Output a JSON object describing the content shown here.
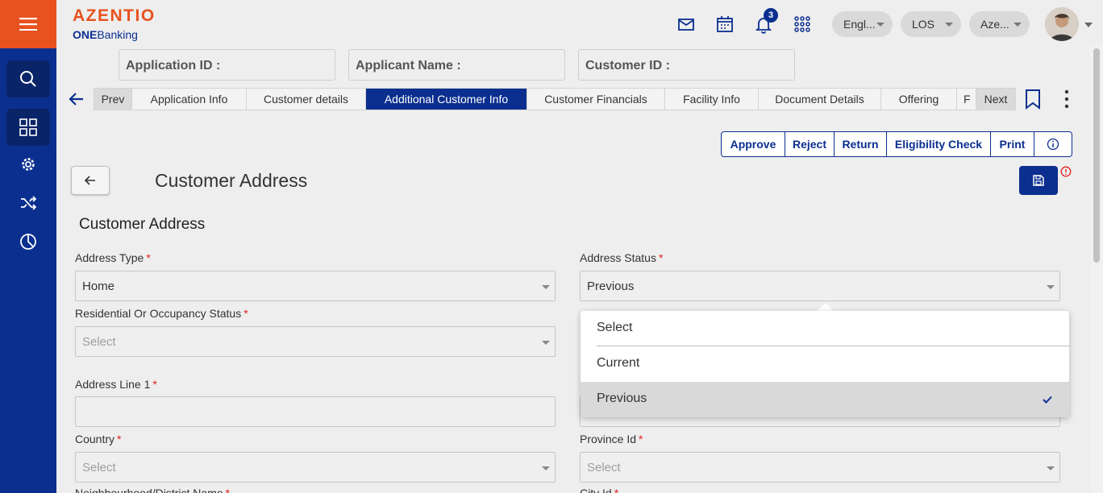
{
  "brand": {
    "name": "AZENTIO",
    "sub_bold": "ONE",
    "sub_rest": "Banking"
  },
  "header": {
    "notification_count": "3",
    "language": "Engl...",
    "module": "LOS",
    "entity": "Aze...",
    "icons": [
      "mail-icon",
      "calendar-icon",
      "bell-icon",
      "apps-grid-icon"
    ]
  },
  "rail": {
    "items": [
      "menu-icon",
      "search-icon",
      "dashboard-icon",
      "settings-icon",
      "shuffle-icon",
      "pie-chart-icon"
    ]
  },
  "id_fields": {
    "application_id": "Application ID :",
    "applicant_name": "Applicant Name :",
    "customer_id": "Customer ID :"
  },
  "tabs": {
    "prev": "Prev",
    "next": "Next",
    "items": [
      "Application Info",
      "Customer details",
      "Additional Customer Info",
      "Customer Financials",
      "Facility Info",
      "Document Details",
      "Offering",
      "F"
    ],
    "active": "Additional Customer Info"
  },
  "actions": [
    "Approve",
    "Reject",
    "Return",
    "Eligibility Check",
    "Print"
  ],
  "page": {
    "title": "Customer Address",
    "section_title": "Customer Address"
  },
  "form": {
    "address_type": {
      "label": "Address Type",
      "value": "Home"
    },
    "address_status": {
      "label": "Address Status",
      "value": "Previous"
    },
    "residential_status": {
      "label": "Residential Or Occupancy Status",
      "placeholder": "Select"
    },
    "address_line_1": {
      "label": "Address Line 1",
      "value": ""
    },
    "country": {
      "label": "Country",
      "placeholder": "Select"
    },
    "province_id": {
      "label": "Province Id",
      "placeholder": "Select"
    },
    "neighbourhood": {
      "label": "Neighbourhood/District Name"
    },
    "city_id": {
      "label": "City Id"
    },
    "required_mark": "*"
  },
  "dropdown": {
    "options": [
      "Select",
      "Current",
      "Previous"
    ],
    "selected": "Previous"
  },
  "colors": {
    "primary": "#0b2f8f",
    "accent": "#e8521f",
    "required": "#e02020"
  }
}
